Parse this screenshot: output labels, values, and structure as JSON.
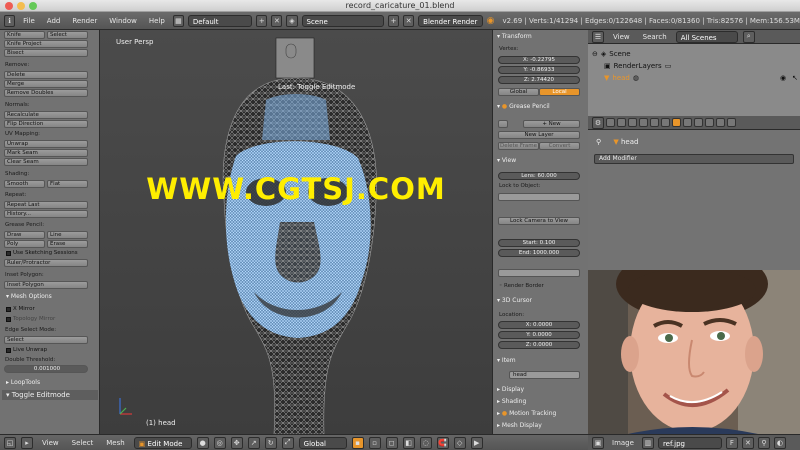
{
  "window": {
    "title": "record_caricature_01.blend"
  },
  "info_header": {
    "menus": [
      "File",
      "Add",
      "Render",
      "Window",
      "Help"
    ],
    "layout": "Default",
    "scene": "Scene",
    "engine": "Blender Render",
    "stats": "v2.69 | Verts:1/41294 | Edges:0/122648 | Faces:0/81360 | Tris:82576 | Mem:156.53M"
  },
  "toolshelf": {
    "top_buttons": [
      "Knife",
      "Select",
      "Knife Project",
      "Bisect"
    ],
    "remove_label": "Remove:",
    "remove_buttons": [
      "Delete",
      "Merge",
      "Remove Doubles"
    ],
    "normals_label": "Normals:",
    "normals_buttons": [
      "Recalculate",
      "Flip Direction"
    ],
    "uv_label": "UV Mapping:",
    "uv_buttons": [
      "Unwrap",
      "Mark Seam",
      "Clear Seam"
    ],
    "shading_label": "Shading:",
    "shading_buttons": [
      "Smooth",
      "Flat"
    ],
    "repeat_label": "Repeat:",
    "repeat_buttons": [
      "Repeat Last",
      "History..."
    ],
    "grease_label": "Grease Pencil:",
    "grease_buttons": [
      "Draw",
      "Line",
      "Poly",
      "Erase"
    ],
    "use_sketching": "Use Sketching Sessions",
    "ruler": "Ruler/Protractor",
    "inset_label": "Inset Polygon:",
    "inset_button": "Inset Polygon",
    "mesh_options_head": "Mesh Options",
    "x_mirror": "X Mirror",
    "topology_mirror": "Topology Mirror",
    "edge_select_label": "Edge Select Mode:",
    "edge_select_value": "Select",
    "live_unwrap": "Live Unwrap",
    "double_threshold_label": "Double Threshold:",
    "double_threshold_value": "0.001000",
    "looptools_head": "LoopTools",
    "toggle_editmode_head": "Toggle Editmode"
  },
  "viewport": {
    "persp_label": "User Persp",
    "last_op": "Last: Toggle Editmode",
    "object_label": "(1) head",
    "watermark": "WWW.CGTSJ.COM",
    "mesh_color": "#7fb3e8"
  },
  "npanel": {
    "transform_head": "Transform",
    "vertex_label": "Vertex:",
    "x": "X: -0.22795",
    "y": "Y: -0.86933",
    "z": "Z: 2.74420",
    "global": "Global",
    "local": "Local",
    "grease_head": "Grease Pencil",
    "new": "New",
    "new_layer": "New Layer",
    "delete_frame": "Delete Frame",
    "convert": "Convert",
    "view_head": "View",
    "lens": "Lens: 60.000",
    "lock_to_object": "Lock to Object:",
    "lock_camera": "Lock Camera to View",
    "start": "Start: 0.100",
    "end": "End: 1000.000",
    "render_border": "Render Border",
    "cursor_head": "3D Cursor",
    "location_label": "Location:",
    "cx": "X: 0.0000",
    "cy": "Y: 0.0000",
    "cz": "Z: 0.0000",
    "item_head": "Item",
    "item_value": "head",
    "display_head": "Display",
    "shading_head": "Shading",
    "motion_head": "Motion Tracking",
    "mesh_display_head": "Mesh Display"
  },
  "outliner": {
    "header_items": [
      "View",
      "Search"
    ],
    "filter": "All Scenes",
    "rows": [
      "Scene",
      "RenderLayers",
      "head"
    ]
  },
  "properties": {
    "object_name": "head",
    "add_modifier": "Add Modifier"
  },
  "image_editor": {
    "menus": [
      "Image"
    ],
    "image_name": "ref.jpg",
    "fake_user": "F"
  },
  "viewport_header": {
    "menus": [
      "View",
      "Select",
      "Mesh"
    ],
    "mode": "Edit Mode",
    "orientation": "Global"
  },
  "colors": {
    "accent": "#e8952a",
    "panel": "#727272",
    "watermark": "#ffee00"
  }
}
